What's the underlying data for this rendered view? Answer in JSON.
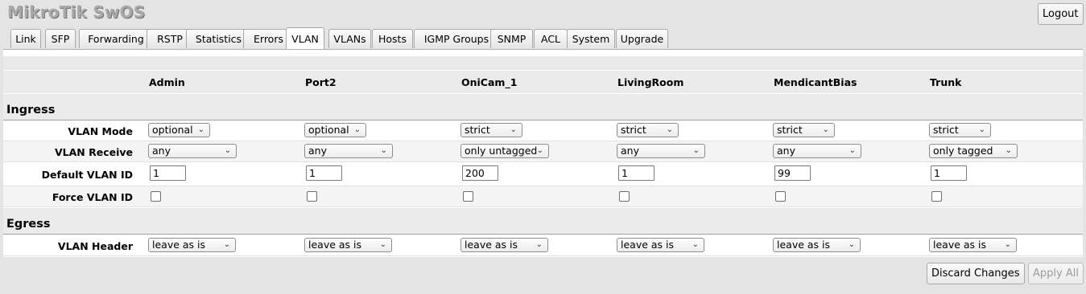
{
  "app": {
    "title": "MikroTik SwOS",
    "logout_label": "Logout"
  },
  "tabs": [
    "Link",
    "SFP",
    "Forwarding",
    "RSTP",
    "Statistics",
    "Errors",
    "VLAN",
    "VLANs",
    "Hosts",
    "IGMP Groups",
    "SNMP",
    "ACL",
    "System",
    "Upgrade"
  ],
  "active_tab": "VLAN",
  "ports": [
    "Admin",
    "Port2",
    "OniCam_1",
    "LivingRoom",
    "MendicantBias",
    "Trunk"
  ],
  "sections": {
    "ingress": "Ingress",
    "egress": "Egress"
  },
  "labels": {
    "vlan_mode": "VLAN Mode",
    "vlan_receive": "VLAN Receive",
    "default_vlan_id": "Default VLAN ID",
    "force_vlan_id": "Force VLAN ID",
    "vlan_header": "VLAN Header"
  },
  "vlan_mode": [
    "optional",
    "optional",
    "strict",
    "strict",
    "strict",
    "strict"
  ],
  "vlan_receive": [
    "any",
    "any",
    "only untagged",
    "any",
    "any",
    "only tagged"
  ],
  "default_vlan_id": [
    "1",
    "1",
    "200",
    "1",
    "99",
    "1"
  ],
  "force_vlan_id": [
    false,
    false,
    false,
    false,
    false,
    false
  ],
  "vlan_header": [
    "leave as is",
    "leave as is",
    "leave as is",
    "leave as is",
    "leave as is",
    "leave as is"
  ],
  "actions": {
    "discard": "Discard Changes",
    "apply": "Apply All"
  }
}
